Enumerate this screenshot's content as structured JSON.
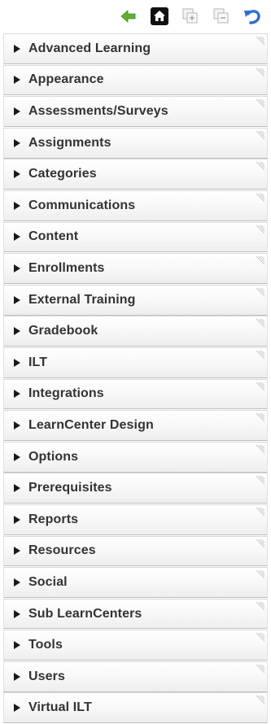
{
  "toolbar": {
    "buttons": [
      {
        "icon": "back-arrow-icon",
        "color": "#5cb230"
      },
      {
        "icon": "home-icon",
        "color": "#111111"
      },
      {
        "icon": "expand-all-icon",
        "color": "#bbbbbb"
      },
      {
        "icon": "collapse-all-icon",
        "color": "#bbbbbb"
      },
      {
        "icon": "undo-icon",
        "color": "#2b6fd6"
      }
    ]
  },
  "menu": {
    "items": [
      {
        "label": "Advanced Learning"
      },
      {
        "label": "Appearance"
      },
      {
        "label": "Assessments/Surveys"
      },
      {
        "label": "Assignments"
      },
      {
        "label": "Categories"
      },
      {
        "label": "Communications"
      },
      {
        "label": "Content"
      },
      {
        "label": "Enrollments"
      },
      {
        "label": "External Training"
      },
      {
        "label": "Gradebook"
      },
      {
        "label": "ILT"
      },
      {
        "label": "Integrations"
      },
      {
        "label": "LearnCenter Design"
      },
      {
        "label": "Options"
      },
      {
        "label": "Prerequisites"
      },
      {
        "label": "Reports"
      },
      {
        "label": "Resources"
      },
      {
        "label": "Social"
      },
      {
        "label": "Sub LearnCenters"
      },
      {
        "label": "Tools"
      },
      {
        "label": "Users"
      },
      {
        "label": "Virtual ILT"
      }
    ]
  }
}
